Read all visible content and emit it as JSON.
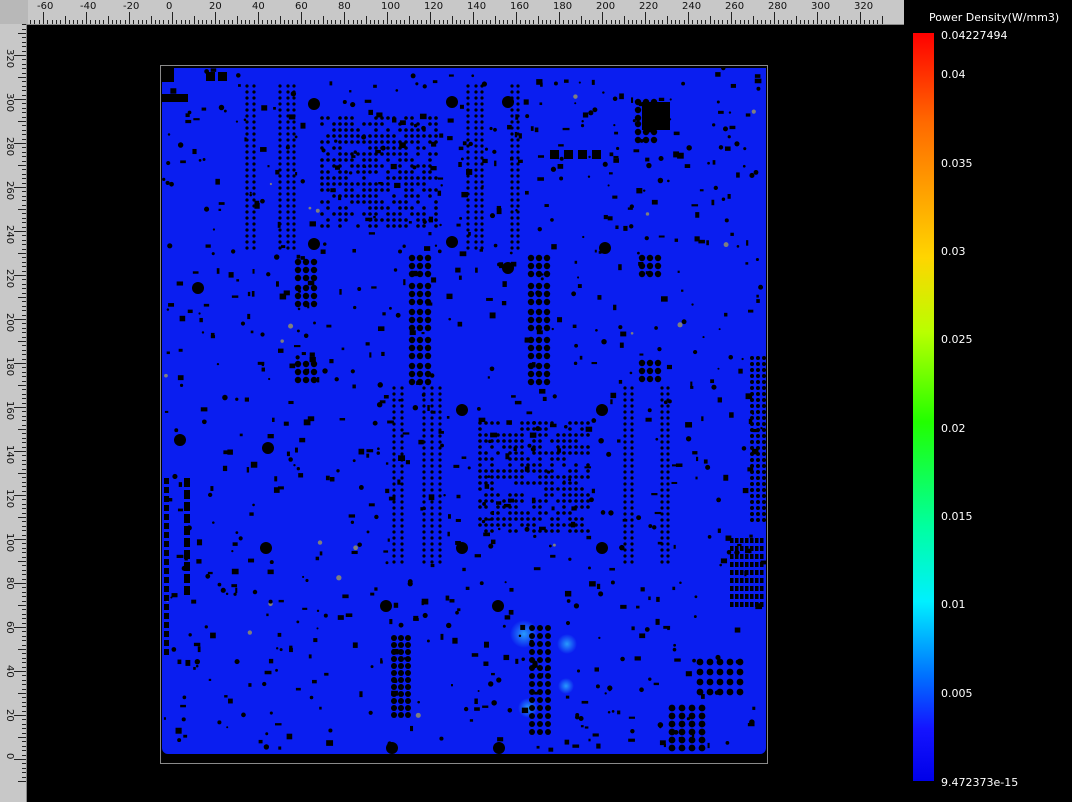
{
  "ruler": {
    "x_labels": [
      "-60",
      "-40",
      "-20",
      "0",
      "20",
      "40",
      "60",
      "80",
      "100",
      "120",
      "140",
      "160",
      "180",
      "200",
      "220",
      "240",
      "260",
      "280",
      "300",
      "320"
    ],
    "y_labels": [
      "320",
      "300",
      "280",
      "260",
      "240",
      "220",
      "200",
      "180",
      "160",
      "140",
      "120",
      "100",
      "80",
      "60",
      "40",
      "20",
      "0"
    ]
  },
  "legend": {
    "title": "Power Density(W/mm3)",
    "max": "0.04227494",
    "ticks": [
      "0.04",
      "0.035",
      "0.03",
      "0.025",
      "0.02",
      "0.015",
      "0.01",
      "0.005"
    ],
    "min": "9.472373e-15"
  },
  "colors": {
    "board": "#0a1ef0",
    "component": "#000000",
    "pad_gray": "#7f7f7f",
    "hotspot": "#2aa8ff",
    "ruler": "#c8c8c8"
  }
}
